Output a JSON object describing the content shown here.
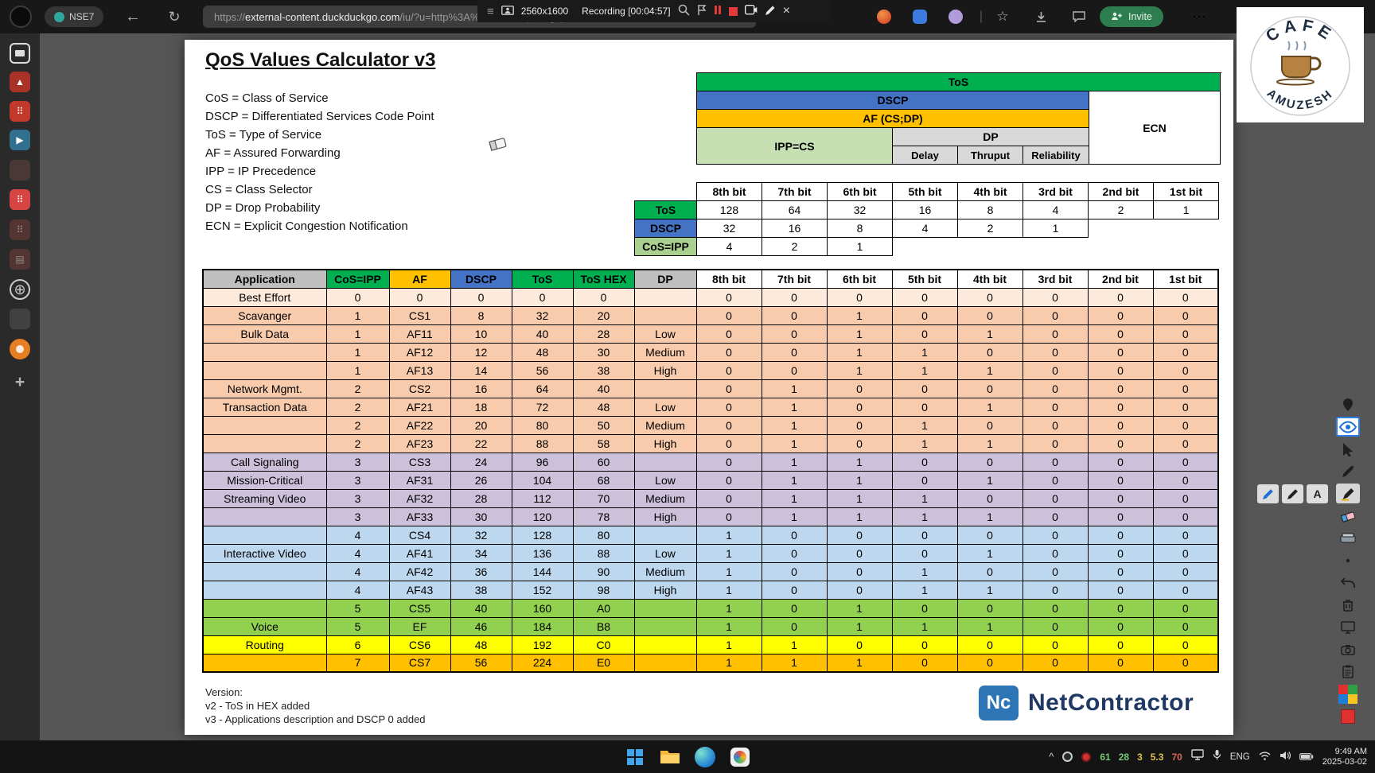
{
  "icons": {
    "menu": "≡",
    "back": "←",
    "reload": "↻",
    "close": "×",
    "star": "☆",
    "ellipsis": "⋯",
    "caret_up": "^",
    "divider": "|"
  },
  "browser": {
    "profile_badge": "NSE7",
    "url_scheme": "https://",
    "url_domain": "external-content.duckduckgo.com",
    "url_path": "/iu/?u=http%3A%2F%2F4.bp.blogspot...",
    "invite_label": "Invite"
  },
  "recorder": {
    "resolution": "2560x1600",
    "status": "Recording [00:04:57]"
  },
  "log o_card_note": "",
  "logo_card": {
    "arc_top": "CAFE",
    "arc_bottom": "AMUZESH"
  },
  "document": {
    "title": "QoS Values Calculator v3",
    "legend": [
      "CoS = Class of Service",
      "DSCP = Differentiated Services Code Point",
      "ToS = Type of Service",
      "AF = Assured Forwarding",
      "IPP = IP Precedence",
      "CS = Class Selector",
      "DP = Drop Probability",
      "ECN = Explicit Congestion Notification"
    ],
    "tos_diagram": {
      "tos": "ToS",
      "dscp": "DSCP",
      "af": "AF (CS;DP)",
      "ipp": "IPP=CS",
      "dp": "DP",
      "dp_cols": [
        "Delay",
        "Thruput",
        "Reliability"
      ],
      "ecn": "ECN"
    },
    "bit_table": {
      "headers": [
        "8th bit",
        "7th bit",
        "6th bit",
        "5th bit",
        "4th bit",
        "3rd bit",
        "2nd bit",
        "1st bit"
      ],
      "rows": [
        {
          "label": "ToS",
          "bg": "#00b050",
          "values": [
            "128",
            "64",
            "32",
            "16",
            "8",
            "4",
            "2",
            "1"
          ]
        },
        {
          "label": "DSCP",
          "bg": "#4472c4",
          "values": [
            "32",
            "16",
            "8",
            "4",
            "2",
            "1"
          ]
        },
        {
          "label": "CoS=IPP",
          "bg": "#a9d08e",
          "values": [
            "4",
            "2",
            "1"
          ]
        }
      ]
    },
    "main_table": {
      "headers": [
        "Application",
        "CoS=IPP",
        "AF",
        "DSCP",
        "ToS",
        "ToS HEX",
        "DP",
        "8th bit",
        "7th bit",
        "6th bit",
        "5th bit",
        "4th bit",
        "3rd bit",
        "2nd bit",
        "1st bit"
      ],
      "header_bgs": [
        "#bfbfbf",
        "#00b050",
        "#ffc000",
        "#4472c4",
        "#00b050",
        "#00b050",
        "#bfbfbf",
        "#ffffff",
        "#ffffff",
        "#ffffff",
        "#ffffff",
        "#ffffff",
        "#ffffff",
        "#ffffff",
        "#ffffff"
      ],
      "rows": [
        {
          "bg": "#fdeada",
          "cells": [
            "Best Effort",
            "0",
            "0",
            "0",
            "0",
            "0",
            "",
            "0",
            "0",
            "0",
            "0",
            "0",
            "0",
            "0",
            "0"
          ]
        },
        {
          "bg": "#f8cbad",
          "cells": [
            "Scavanger",
            "1",
            "CS1",
            "8",
            "32",
            "20",
            "",
            "0",
            "0",
            "1",
            "0",
            "0",
            "0",
            "0",
            "0"
          ]
        },
        {
          "bg": "#f8cbad",
          "cells": [
            "Bulk Data",
            "1",
            "AF11",
            "10",
            "40",
            "28",
            "Low",
            "0",
            "0",
            "1",
            "0",
            "1",
            "0",
            "0",
            "0"
          ]
        },
        {
          "bg": "#f8cbad",
          "cells": [
            "",
            "1",
            "AF12",
            "12",
            "48",
            "30",
            "Medium",
            "0",
            "0",
            "1",
            "1",
            "0",
            "0",
            "0",
            "0"
          ]
        },
        {
          "bg": "#f8cbad",
          "cells": [
            "",
            "1",
            "AF13",
            "14",
            "56",
            "38",
            "High",
            "0",
            "0",
            "1",
            "1",
            "1",
            "0",
            "0",
            "0"
          ]
        },
        {
          "bg": "#f8cbad",
          "cells": [
            "Network Mgmt.",
            "2",
            "CS2",
            "16",
            "64",
            "40",
            "",
            "0",
            "1",
            "0",
            "0",
            "0",
            "0",
            "0",
            "0"
          ]
        },
        {
          "bg": "#f8cbad",
          "cells": [
            "Transaction Data",
            "2",
            "AF21",
            "18",
            "72",
            "48",
            "Low",
            "0",
            "1",
            "0",
            "0",
            "1",
            "0",
            "0",
            "0"
          ]
        },
        {
          "bg": "#f8cbad",
          "cells": [
            "",
            "2",
            "AF22",
            "20",
            "80",
            "50",
            "Medium",
            "0",
            "1",
            "0",
            "1",
            "0",
            "0",
            "0",
            "0"
          ]
        },
        {
          "bg": "#f8cbad",
          "cells": [
            "",
            "2",
            "AF23",
            "22",
            "88",
            "58",
            "High",
            "0",
            "1",
            "0",
            "1",
            "1",
            "0",
            "0",
            "0"
          ]
        },
        {
          "bg": "#ccc0da",
          "cells": [
            "Call Signaling",
            "3",
            "CS3",
            "24",
            "96",
            "60",
            "",
            "0",
            "1",
            "1",
            "0",
            "0",
            "0",
            "0",
            "0"
          ]
        },
        {
          "bg": "#ccc0da",
          "cells": [
            "Mission-Critical",
            "3",
            "AF31",
            "26",
            "104",
            "68",
            "Low",
            "0",
            "1",
            "1",
            "0",
            "1",
            "0",
            "0",
            "0"
          ]
        },
        {
          "bg": "#ccc0da",
          "cells": [
            "Streaming Video",
            "3",
            "AF32",
            "28",
            "112",
            "70",
            "Medium",
            "0",
            "1",
            "1",
            "1",
            "0",
            "0",
            "0",
            "0"
          ]
        },
        {
          "bg": "#ccc0da",
          "cells": [
            "",
            "3",
            "AF33",
            "30",
            "120",
            "78",
            "High",
            "0",
            "1",
            "1",
            "1",
            "1",
            "0",
            "0",
            "0"
          ]
        },
        {
          "bg": "#bdd7ee",
          "cells": [
            "",
            "4",
            "CS4",
            "32",
            "128",
            "80",
            "",
            "1",
            "0",
            "0",
            "0",
            "0",
            "0",
            "0",
            "0"
          ]
        },
        {
          "bg": "#bdd7ee",
          "cells": [
            "Interactive Video",
            "4",
            "AF41",
            "34",
            "136",
            "88",
            "Low",
            "1",
            "0",
            "0",
            "0",
            "1",
            "0",
            "0",
            "0"
          ]
        },
        {
          "bg": "#bdd7ee",
          "cells": [
            "",
            "4",
            "AF42",
            "36",
            "144",
            "90",
            "Medium",
            "1",
            "0",
            "0",
            "1",
            "0",
            "0",
            "0",
            "0"
          ]
        },
        {
          "bg": "#bdd7ee",
          "cells": [
            "",
            "4",
            "AF43",
            "38",
            "152",
            "98",
            "High",
            "1",
            "0",
            "0",
            "1",
            "1",
            "0",
            "0",
            "0"
          ]
        },
        {
          "bg": "#92d050",
          "cells": [
            "",
            "5",
            "CS5",
            "40",
            "160",
            "A0",
            "",
            "1",
            "0",
            "1",
            "0",
            "0",
            "0",
            "0",
            "0"
          ]
        },
        {
          "bg": "#92d050",
          "cells": [
            "Voice",
            "5",
            "EF",
            "46",
            "184",
            "B8",
            "",
            "1",
            "0",
            "1",
            "1",
            "1",
            "0",
            "0",
            "0"
          ]
        },
        {
          "bg": "#ffff00",
          "cells": [
            "Routing",
            "6",
            "CS6",
            "48",
            "192",
            "C0",
            "",
            "1",
            "1",
            "0",
            "0",
            "0",
            "0",
            "0",
            "0"
          ]
        },
        {
          "bg": "#ffc000",
          "cells": [
            "",
            "7",
            "CS7",
            "56",
            "224",
            "E0",
            "",
            "1",
            "1",
            "1",
            "0",
            "0",
            "0",
            "0",
            "0"
          ]
        }
      ]
    },
    "version_lines": [
      "Version:",
      "v2 - ToS in HEX added",
      "v3 - Applications description and DSCP 0  added"
    ],
    "brand": {
      "abbr": "Nc",
      "name": "NetContractor"
    }
  },
  "sidebar": {
    "items": [
      {
        "name": "screen-share-icon",
        "kind": "outline",
        "glyph": ""
      },
      {
        "name": "app-chart-icon",
        "kind": "square",
        "color": "#a93226",
        "glyph": "▲"
      },
      {
        "name": "app-dice-icon",
        "kind": "square",
        "color": "#c0392b",
        "glyph": "⠿"
      },
      {
        "name": "app-play-icon",
        "kind": "square",
        "color": "#31708e",
        "glyph": "▶"
      },
      {
        "name": "app-dim-icon-1",
        "kind": "square",
        "color": "#6e4a44",
        "glyph": "",
        "dim": true
      },
      {
        "name": "app-grid-icon",
        "kind": "square",
        "color": "#d64541",
        "glyph": "⠿"
      },
      {
        "name": "app-dim-icon-2",
        "kind": "square",
        "color": "#8a443c",
        "glyph": "⠿",
        "dim": true
      },
      {
        "name": "app-dim-icon-3",
        "kind": "square",
        "color": "#8a443c",
        "glyph": "▤",
        "dim": true
      },
      {
        "name": "globe-icon",
        "kind": "globe",
        "glyph": "⊕"
      },
      {
        "name": "app-dim-icon-4",
        "kind": "square",
        "color": "#5d5d5d",
        "glyph": "",
        "dim": true
      },
      {
        "name": "app-orange-icon",
        "kind": "circle",
        "color": "#e67e22",
        "glyph": ""
      },
      {
        "name": "add-page-icon",
        "kind": "plus",
        "glyph": "+"
      }
    ]
  },
  "right_toolbar": {
    "tools": [
      {
        "name": "pin-tool-icon"
      },
      {
        "name": "eye-tool-icon",
        "selected": "blue"
      },
      {
        "name": "cursor-tool-icon"
      },
      {
        "name": "pen-tool-icon"
      },
      {
        "name": "marker-tool-icon",
        "selected": "gray"
      },
      {
        "name": "eraser-tool-icon"
      },
      {
        "name": "wide-eraser-tool-icon"
      },
      {
        "name": "dot-size-icon"
      },
      {
        "name": "undo-icon"
      },
      {
        "name": "trash-icon"
      },
      {
        "name": "screen-tool-icon"
      },
      {
        "name": "camera-tool-icon"
      },
      {
        "name": "clipboard-tool-icon"
      },
      {
        "name": "palette-icon"
      },
      {
        "name": "color-swatch-icon"
      }
    ]
  },
  "floating_tools": [
    {
      "name": "pen-blue-icon",
      "color": "#1d6fd6",
      "label": ""
    },
    {
      "name": "pen-black-icon",
      "color": "#222222",
      "label": ""
    },
    {
      "name": "text-tool-icon",
      "color": "",
      "label": "A"
    }
  ],
  "taskbar": {
    "stats": [
      {
        "value": "61",
        "color": "#79c879"
      },
      {
        "value": "28",
        "color": "#79c879"
      },
      {
        "value": "3",
        "color": "#e2c04c"
      },
      {
        "value": "5.3",
        "color": "#e2c04c"
      },
      {
        "value": "70",
        "color": "#e06060"
      }
    ],
    "language": "ENG",
    "time": "9:49 AM",
    "date": "2025-03-02"
  }
}
